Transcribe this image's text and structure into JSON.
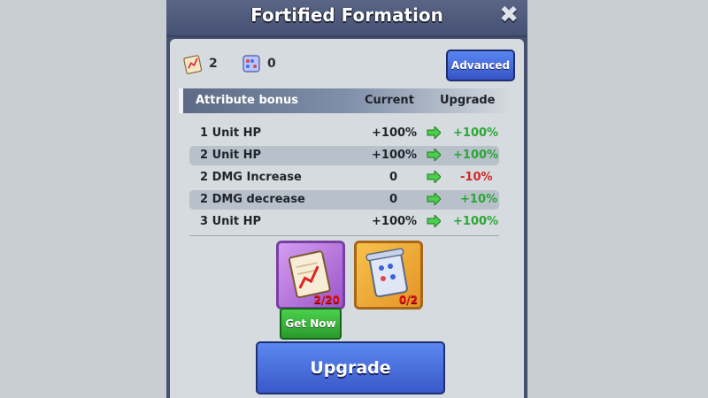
{
  "window": {
    "title": "Fortified Formation",
    "close_symbol": "✖"
  },
  "resources": [
    {
      "icon": "chart-document-icon",
      "count": "2"
    },
    {
      "icon": "abacus-icon",
      "count": "0"
    }
  ],
  "advanced_button": "Advanced",
  "table": {
    "headers": {
      "attribute": "Attribute bonus",
      "current": "Current",
      "upgrade": "Upgrade"
    },
    "rows": [
      {
        "attribute": "1 Unit HP",
        "current": "+100%",
        "upgrade": "+100%",
        "upgrade_color": "#2aa635"
      },
      {
        "attribute": "2 Unit HP",
        "current": "+100%",
        "upgrade": "+100%",
        "upgrade_color": "#2aa635"
      },
      {
        "attribute": "2 DMG Increase",
        "current": "0",
        "upgrade": "-10%",
        "upgrade_color": "#d12727"
      },
      {
        "attribute": "2 DMG decrease",
        "current": "0",
        "upgrade": "+10%",
        "upgrade_color": "#2aa635"
      },
      {
        "attribute": "3 Unit HP",
        "current": "+100%",
        "upgrade": "+100%",
        "upgrade_color": "#2aa635"
      }
    ]
  },
  "items": [
    {
      "icon": "chart-document-icon",
      "count": "2/20"
    },
    {
      "icon": "scroll-icon",
      "count": "0/2"
    }
  ],
  "get_now_button": "Get Now",
  "upgrade_button": "Upgrade",
  "colors": {
    "accent_blue": "#3e5fd0",
    "get_now_green": "#33b03a",
    "arrow_green": "#4ccf4c"
  }
}
